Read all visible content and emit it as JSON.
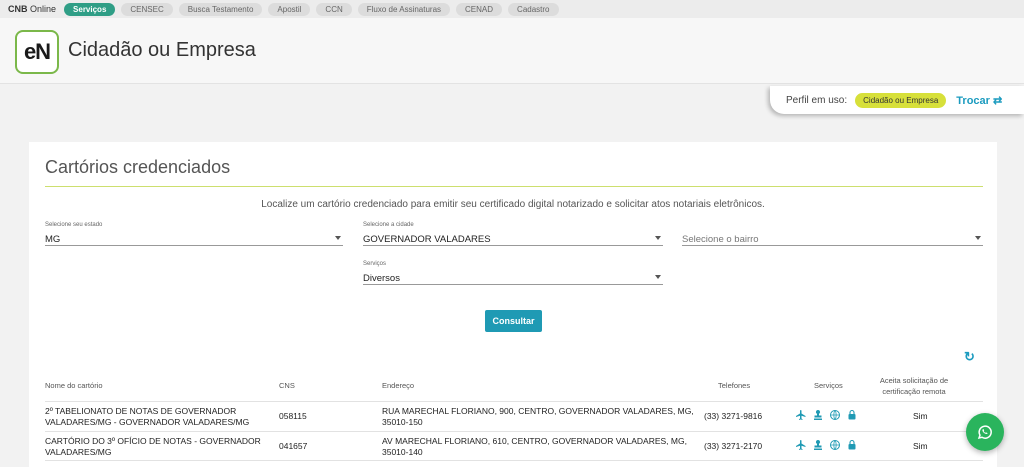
{
  "topbar": {
    "brand_bold": "CNB",
    "brand_rest": " Online",
    "items": [
      "Serviços",
      "CENSEC",
      "Busca Testamento",
      "Apostil",
      "CCN",
      "Fluxo de Assinaturas",
      "CENAD",
      "Cadastro"
    ],
    "active_index": 0
  },
  "header": {
    "logo_text": "eN",
    "title": "Cidadão ou Empresa"
  },
  "profile": {
    "label": "Perfil em uso:",
    "badge": "Cidadão ou Empresa",
    "switch_label": "Trocar"
  },
  "card": {
    "title": "Cartórios credenciados",
    "intro": "Localize um cartório credenciado para emitir seu certificado digital notarizado e solicitar atos notariais eletrônicos."
  },
  "filters": {
    "estado": {
      "label": "Selecione seu estado",
      "value": "MG"
    },
    "cidade": {
      "label": "Selecione a cidade",
      "value": "GOVERNADOR VALADARES"
    },
    "bairro": {
      "placeholder": "Selecione o bairro"
    },
    "servicos": {
      "label": "Serviços",
      "value": "Diversos"
    }
  },
  "actions": {
    "consultar": "Consultar"
  },
  "table": {
    "headers": [
      "Nome do cartório",
      "CNS",
      "Endereço",
      "Telefones",
      "Serviços",
      "Aceita solicitação de",
      "certificação remota"
    ],
    "rows": [
      {
        "nome1": "2º TABELIONATO DE NOTAS DE GOVERNADOR",
        "nome2": "VALADARES/MG - GOVERNADOR VALADARES/MG",
        "cns": "058115",
        "end1": "RUA MARECHAL FLORIANO, 900, CENTRO, GOVERNADOR VALADARES, MG,",
        "end2": "35010-150",
        "tel": "(33) 3271-9816",
        "remota": "Sim"
      },
      {
        "nome1": "CARTÓRIO DO 3º OFÍCIO DE NOTAS - GOVERNADOR",
        "nome2": "VALADARES/MG",
        "cns": "041657",
        "end1": "AV MARECHAL FLORIANO, 610, CENTRO, GOVERNADOR VALADARES, MG,",
        "end2": "35010-140",
        "tel": "(33) 3271-2170",
        "remota": "Sim"
      }
    ],
    "service_icons": [
      "airplane-icon",
      "notary-stamp-icon",
      "globe-icon",
      "lock-icon"
    ]
  },
  "colors": {
    "accent": "#1f9ab4",
    "active_pill": "#2f9e86",
    "badge": "#d7e03a",
    "whatsapp": "#2ab45d",
    "rule": "#cddf6e"
  }
}
